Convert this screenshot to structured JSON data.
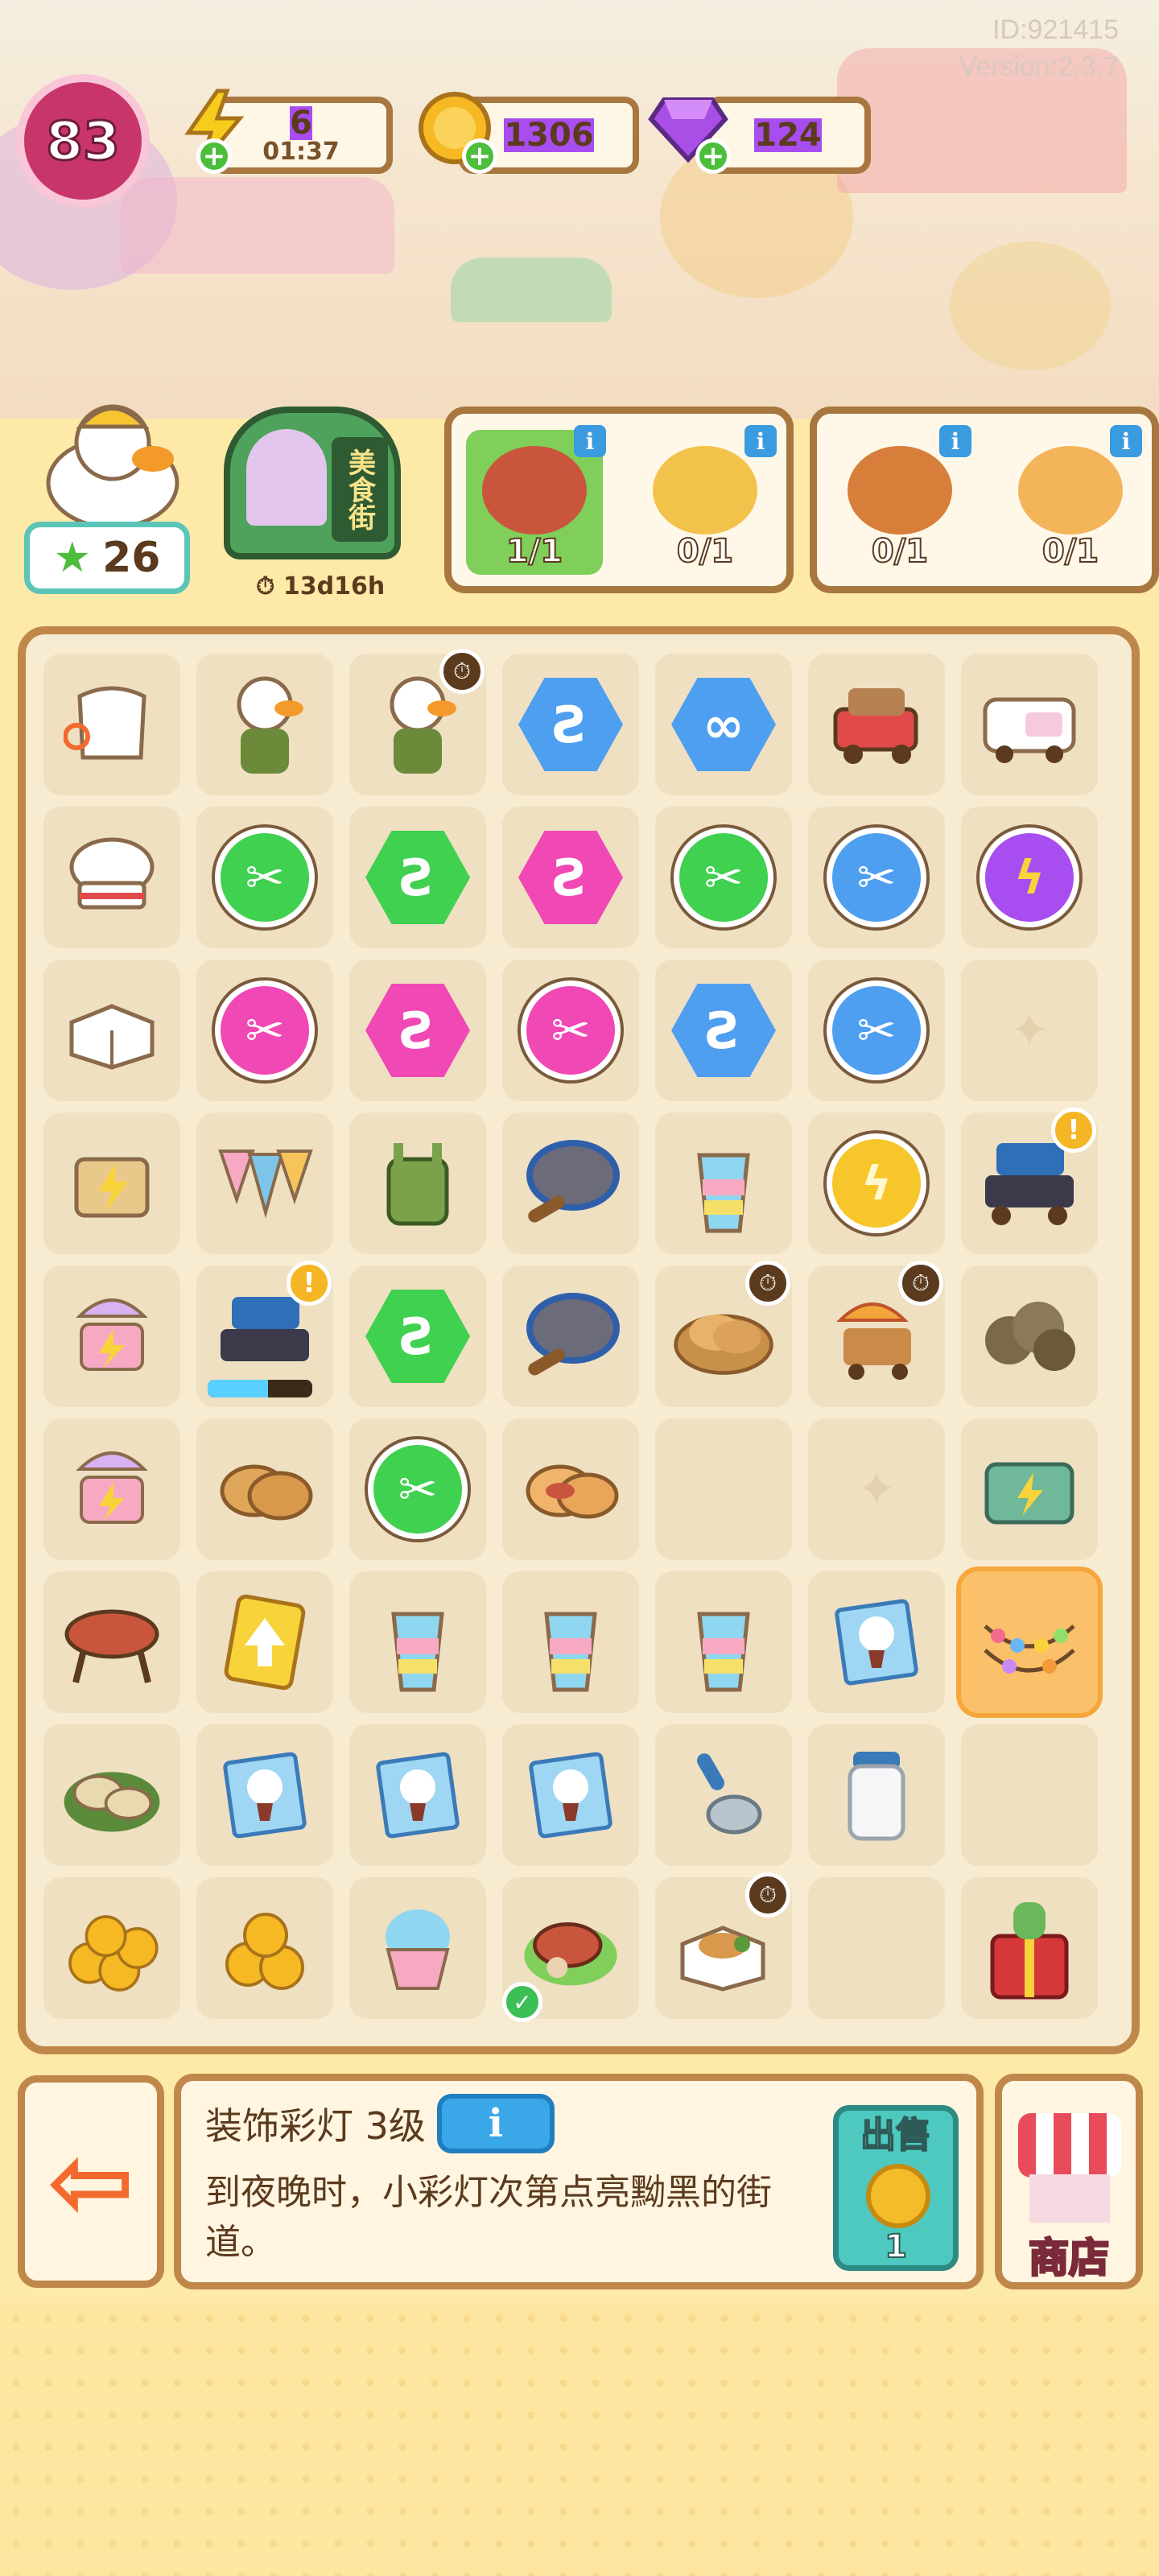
{
  "meta": {
    "id": "ID:921415",
    "version": "Version:2.3.7"
  },
  "top_bar": {
    "level": "83",
    "energy": {
      "value": "6",
      "timer": "01:37",
      "icon": "lightning-icon"
    },
    "coins": {
      "value": "1306",
      "icon": "coin-icon"
    },
    "gems": {
      "value": "124",
      "icon": "gem-icon"
    }
  },
  "player": {
    "stars": "26"
  },
  "event": {
    "label": "美食街",
    "timer": "13d16h"
  },
  "orders": [
    {
      "item": "steak-plate",
      "count": "1/1",
      "done": true
    },
    {
      "item": "omelette",
      "count": "0/1",
      "done": false
    },
    {
      "item": "salad-cup",
      "count": "0/1",
      "done": false
    },
    {
      "item": "tiger-duck",
      "count": "0/1",
      "done": false
    }
  ],
  "board": {
    "rows": [
      [
        "apron",
        "duck-vendor",
        "duck-vendor-timed",
        "blue-hex-gem",
        "blue-hex-infinite",
        "delivery-truck",
        "food-truck"
      ],
      [
        "chef-hat",
        "green-scissors",
        "green-hex-gem",
        "pink-hex-gem",
        "green-scissors",
        "blue-scissors",
        "purple-energy"
      ],
      [
        "takeout-box",
        "pink-scissors",
        "pink-hex-gem",
        "pink-scissors",
        "blue-hex-gem",
        "blue-scissors",
        "empty-star"
      ],
      [
        "cart-energy",
        "bunting-flags",
        "overalls",
        "frying-pan",
        "rainbow-drink",
        "energy-coin",
        "bbq-cart-alert"
      ],
      [
        "cart-umbrella",
        "bbq-grill-progress",
        "green-hex-gem",
        "frying-pan",
        "pancake-basket-timed",
        "ice-cart-timed",
        "smoke-pile"
      ],
      [
        "cart-umbrella",
        "pancakes",
        "green-scissors",
        "stuffed-pancakes",
        "empty",
        "empty-star",
        "energy-case"
      ],
      [
        "bbq-grill",
        "upgrade-card",
        "rainbow-drink",
        "rainbow-drink",
        "rainbow-drink",
        "duck-poster",
        "string-lights-selected"
      ],
      [
        "oyster-plate",
        "duck-poster",
        "duck-poster",
        "duck-poster",
        "scoop",
        "milk-jar",
        "empty"
      ],
      [
        "coin-pile-big",
        "coin-pile",
        "shaved-ice",
        "steak-plate-check",
        "bento-timed",
        "empty",
        "gift-cactus"
      ]
    ]
  },
  "selected_item": {
    "title": "装饰彩灯 3级",
    "info_label": "i",
    "description": "到夜晚时，小彩灯次第点亮黝黑的街道。",
    "sell_label": "出售",
    "sell_value": "1"
  },
  "footer": {
    "shop_label": "商店",
    "exit_icon": "exit-arrow-icon"
  },
  "colors": {
    "board_border": "#c0874b",
    "panel_bg": "#fff5e0",
    "level_ring": "#c7356b"
  }
}
